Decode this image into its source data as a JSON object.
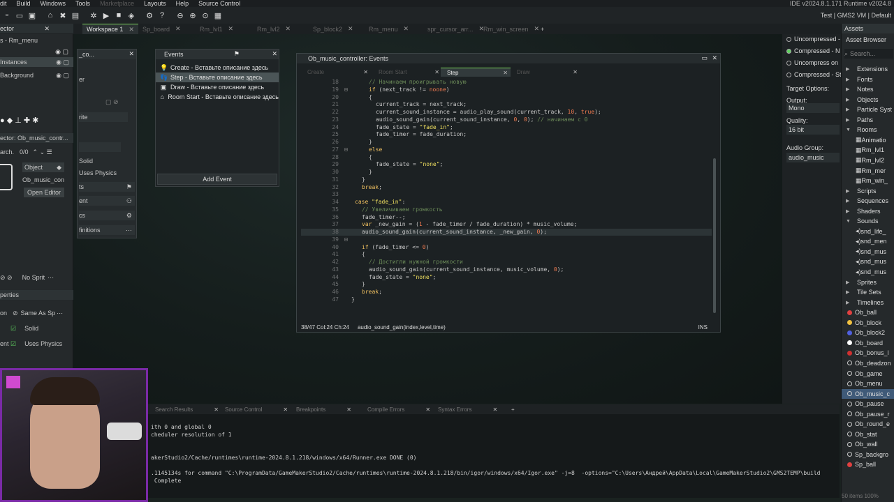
{
  "menu": [
    "dit",
    "Build",
    "Windows",
    "Tools",
    "Marketplace",
    "Layouts",
    "Help",
    "Source Control"
  ],
  "ide_version": "IDE v2024.8.1.171  Runtime v2024.8",
  "runtime_target": "Test | GMS2 VM | Default",
  "left_panel": {
    "header": "ector",
    "room": "s - Rm_menu",
    "layers": [
      "Instances",
      "Background"
    ],
    "instance_label": "ector: Ob_music_contr...",
    "search": "arch.",
    "count": "0/0",
    "object_label": "Object",
    "object_name": "Ob_music_con",
    "open_editor": "Open Editor",
    "no_sprite": "No Sprit",
    "properties": "perties",
    "same_as": "Same As Sp",
    "solid": "Solid",
    "uses_physics": "Uses Physics",
    "on": "on",
    "ent": "ent"
  },
  "obj_window": {
    "title": "_co...",
    "rows": [
      "er",
      "rite",
      "Solid",
      "Uses Physics",
      "ts",
      "ent",
      "cs",
      "finitions"
    ]
  },
  "workspace_tabs": [
    {
      "label": "Workspace 1",
      "active": true
    },
    {
      "label": "Sp_board",
      "active": false
    },
    {
      "label": "Rm_lvl1",
      "active": false
    },
    {
      "label": "Rm_lvl2",
      "active": false
    },
    {
      "label": "Sp_block2",
      "active": false
    },
    {
      "label": "Rm_menu",
      "active": false
    },
    {
      "label": "spr_cursor_arr...",
      "active": false
    },
    {
      "label": "Rm_win_screen",
      "active": false
    }
  ],
  "events_window": {
    "title": "Events",
    "events": [
      {
        "label": "Create - Вставьте описание здесь",
        "icon": "lightbulb-icon",
        "selected": false
      },
      {
        "label": "Step - Вставьте описание здесь",
        "icon": "footstep-icon",
        "selected": true
      },
      {
        "label": "Draw - Вставьте описание здесь",
        "icon": "draw-icon",
        "selected": false
      },
      {
        "label": "Room Start - Вставьте описание здесь",
        "icon": "room-icon",
        "selected": false
      }
    ],
    "add_event": "Add Event"
  },
  "code_window": {
    "title": "Ob_music_controller: Events",
    "tabs": [
      "Create",
      "Room Start",
      "Step",
      "Draw"
    ],
    "active_tab": "Step",
    "status": "38/47 Col:24 Ch:24",
    "hint": "audio_sound_gain(index,level,time)",
    "mode": "INS",
    "lines": [
      {
        "n": "18",
        "h": "<span class='cm'>// Начинаем проигрывать новую</span>",
        "i": 5
      },
      {
        "n": "19",
        "h": "<span class='kw'>if</span> (next_track != <span class='nm'>noone</span>)",
        "i": 5
      },
      {
        "n": "20",
        "h": "{",
        "i": 5
      },
      {
        "n": "21",
        "h": "current_track = next_track;",
        "i": 7
      },
      {
        "n": "22",
        "h": "current_sound_instance = audio_play_sound(current_track, <span class='nm'>10</span>, <span class='nm'>true</span>);",
        "i": 7
      },
      {
        "n": "23",
        "h": "audio_sound_gain(current_sound_instance, <span class='nm'>0</span>, <span class='nm'>0</span>); <span class='cm'>// начинаем с 0</span>",
        "i": 7
      },
      {
        "n": "24",
        "h": "fade_state = <span class='st'>\"fade_in\"</span>;",
        "i": 7
      },
      {
        "n": "25",
        "h": "fade_timer = fade_duration;",
        "i": 7
      },
      {
        "n": "26",
        "h": "}",
        "i": 5
      },
      {
        "n": "27",
        "h": "<span class='kw'>else</span>",
        "i": 5
      },
      {
        "n": "28",
        "h": "{",
        "i": 5
      },
      {
        "n": "29",
        "h": "fade_state = <span class='st'>\"none\"</span>;",
        "i": 7
      },
      {
        "n": "30",
        "h": "}",
        "i": 5
      },
      {
        "n": "31",
        "h": "}",
        "i": 3
      },
      {
        "n": "32",
        "h": "<span class='kw'>break</span>;",
        "i": 3
      },
      {
        "n": "33",
        "h": "",
        "i": 0
      },
      {
        "n": "34",
        "h": "<span class='kw'>case</span> <span class='st'>\"fade_in\"</span>:",
        "i": 1
      },
      {
        "n": "35",
        "h": "<span class='cm'>// Увеличиваем громкость</span>",
        "i": 3
      },
      {
        "n": "36",
        "h": "fade_timer--;",
        "i": 3
      },
      {
        "n": "37",
        "h": "<span class='kw'>var</span> _new_gain = (<span class='nm'>1</span> - fade_timer / fade_duration) * music_volume;",
        "i": 3
      },
      {
        "n": "38",
        "h": "audio_sound_gain(current_sound_instance, _new_gain, <span class='nm'>0</span>);",
        "i": 3,
        "cur": true
      },
      {
        "n": "39",
        "h": "",
        "i": 0
      },
      {
        "n": "40",
        "h": "<span class='kw'>if</span> (fade_timer &lt;= <span class='nm'>0</span>)",
        "i": 3
      },
      {
        "n": "41",
        "h": "{",
        "i": 3
      },
      {
        "n": "42",
        "h": "<span class='cm'>// Достигли нужной громкости</span>",
        "i": 5
      },
      {
        "n": "43",
        "h": "audio_sound_gain(current_sound_instance, music_volume, <span class='nm'>0</span>);",
        "i": 5
      },
      {
        "n": "44",
        "h": "fade_state = <span class='st'>\"none\"</span>;",
        "i": 5
      },
      {
        "n": "45",
        "h": "}",
        "i": 3
      },
      {
        "n": "46",
        "h": "<span class='kw'>break</span>;",
        "i": 3
      },
      {
        "n": "47",
        "h": "}",
        "i": 0
      }
    ]
  },
  "sound_props": {
    "compression": [
      "Uncompressed -",
      "Compressed - N",
      "Uncompress on",
      "Compressed - St"
    ],
    "target_options": "Target Options:",
    "output_label": "Output:",
    "output_value": "Mono",
    "quality_label": "Quality:",
    "quality_value": "16 bit",
    "audio_group_label": "Audio Group:",
    "audio_group_value": "audio_music"
  },
  "assets": {
    "tab": "Assets",
    "browser": "Asset Browser",
    "search": "Search...",
    "items": [
      {
        "label": "Extensions",
        "type": "folder"
      },
      {
        "label": "Fonts",
        "type": "folder"
      },
      {
        "label": "Notes",
        "type": "folder"
      },
      {
        "label": "Objects",
        "type": "folder"
      },
      {
        "label": "Particle Syst",
        "type": "folder"
      },
      {
        "label": "Paths",
        "type": "folder"
      },
      {
        "label": "Rooms",
        "type": "open"
      },
      {
        "label": "Animatio",
        "type": "room"
      },
      {
        "label": "Rm_lvl1",
        "type": "room"
      },
      {
        "label": "Rm_lvl2",
        "type": "room"
      },
      {
        "label": "Rm_mer",
        "type": "room"
      },
      {
        "label": "Rm_win_",
        "type": "room"
      },
      {
        "label": "Scripts",
        "type": "folder"
      },
      {
        "label": "Sequences",
        "type": "folder"
      },
      {
        "label": "Shaders",
        "type": "folder"
      },
      {
        "label": "Sounds",
        "type": "open"
      },
      {
        "label": "snd_life_",
        "type": "sound"
      },
      {
        "label": "snd_men",
        "type": "sound"
      },
      {
        "label": "snd_mus",
        "type": "sound"
      },
      {
        "label": "snd_mus",
        "type": "sound"
      },
      {
        "label": "snd_mus",
        "type": "sound"
      },
      {
        "label": "Sprites",
        "type": "folder"
      },
      {
        "label": "Tile Sets",
        "type": "folder"
      },
      {
        "label": "Timelines",
        "type": "folder"
      },
      {
        "label": "Ob_ball",
        "type": "obj",
        "color": "#e04040"
      },
      {
        "label": "Ob_block",
        "type": "obj",
        "color": "#f0c040"
      },
      {
        "label": "Ob_block2",
        "type": "obj",
        "color": "#5060e0"
      },
      {
        "label": "Ob_board",
        "type": "obj",
        "color": "#ffffff"
      },
      {
        "label": "Ob_bonus_l",
        "type": "obj",
        "color": "#d03030"
      },
      {
        "label": "Ob_deadzon",
        "type": "obj",
        "color": ""
      },
      {
        "label": "Ob_game",
        "type": "obj",
        "color": ""
      },
      {
        "label": "Ob_menu",
        "type": "obj",
        "color": ""
      },
      {
        "label": "Ob_music_c",
        "type": "obj",
        "color": "",
        "selected": true
      },
      {
        "label": "Ob_pause",
        "type": "obj",
        "color": ""
      },
      {
        "label": "Ob_pause_r",
        "type": "obj",
        "color": ""
      },
      {
        "label": "Ob_round_e",
        "type": "obj",
        "color": ""
      },
      {
        "label": "Ob_stat",
        "type": "obj",
        "color": ""
      },
      {
        "label": "Ob_wall",
        "type": "obj",
        "color": ""
      },
      {
        "label": "Sp_backgro",
        "type": "sprite",
        "color": ""
      },
      {
        "label": "Sp_ball",
        "type": "sprite",
        "color": "#e04040"
      }
    ],
    "footer": "50 items  100%"
  },
  "output_tabs": [
    "Search Results",
    "Source Control",
    "Breakpoints",
    "Compile Errors",
    "Syntax Errors"
  ],
  "output_lines": [
    "ith 0 and global 0",
    "cheduler resolution of 1",
    "",
    "",
    "akerStudio2/Cache/runtimes\\runtime-2024.8.1.218/windows/x64/Runner.exe DONE (0)",
    "",
    ".1145134s for command \"C:\\ProgramData/GameMakerStudio2/Cache/runtimes\\runtime-2024.8.1.218/bin/igor/windows/x64/Igor.exe\" -j=8  -options=\"C:\\Users\\Андрей\\AppData\\Local\\GameMakerStudio2\\GMS2TEMP\\build",
    " Complete"
  ]
}
